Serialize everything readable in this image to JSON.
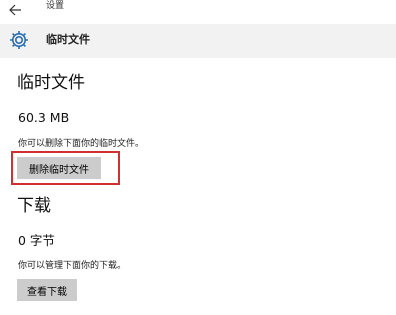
{
  "window": {
    "title": "设置"
  },
  "header": {
    "title": "临时文件"
  },
  "temp_files": {
    "heading": "临时文件",
    "size": "60.3 MB",
    "description": "你可以删除下面你的临时文件。",
    "delete_button": "删除临时文件"
  },
  "downloads": {
    "heading": "下载",
    "size": "0 字节",
    "description": "你可以管理下面你的下载。",
    "view_button": "查看下载"
  },
  "colors": {
    "highlight": "#d03030",
    "button_bg": "#cccccc",
    "header_bg": "#f2f2f2",
    "gear_icon": "#2a6db0"
  }
}
